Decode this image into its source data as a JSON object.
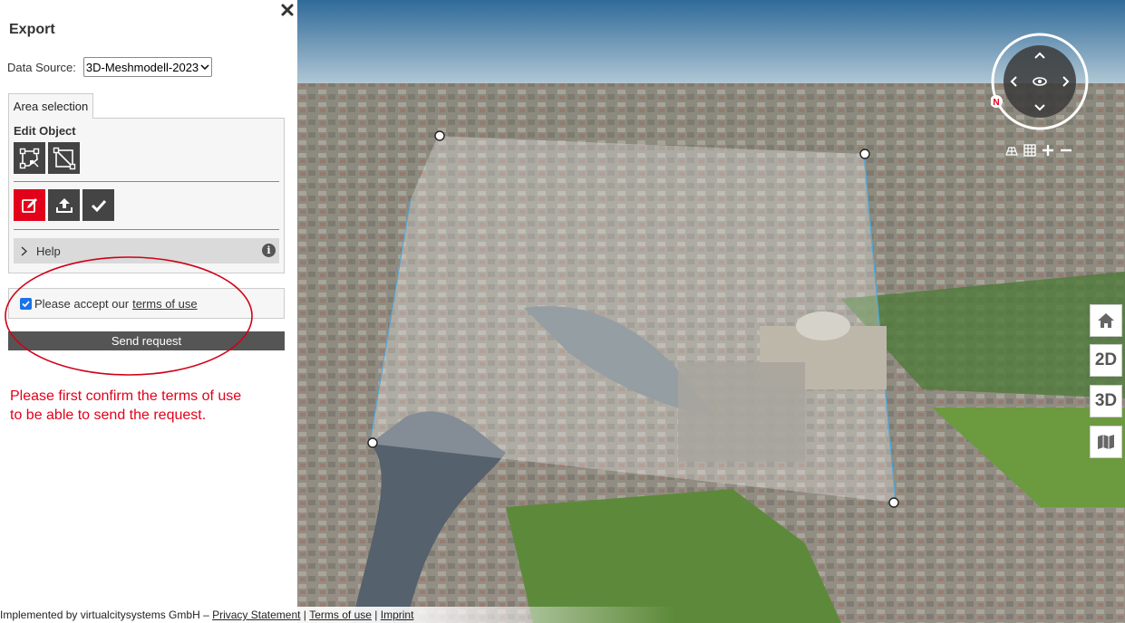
{
  "panel": {
    "title": "Export",
    "data_source_label": "Data Source:",
    "data_source_value": "3D-Meshmodell-2023",
    "tab_label": "Area selection",
    "edit_object_label": "Edit Object",
    "help_label": "Help",
    "terms_text": "Please accept our",
    "terms_link": "terms of use",
    "terms_checked": true,
    "send_button": "Send request",
    "annotation_line1": "Please first confirm the terms of use",
    "annotation_line2": "to be able to send the request."
  },
  "map": {
    "compass_letter": "N",
    "side_buttons": {
      "btn_2d": "2D",
      "btn_3d": "3D"
    }
  },
  "footer": {
    "prefix": "Implemented by virtualcitysystems GmbH – ",
    "privacy": "Privacy Statement",
    "sep1": " | ",
    "terms": "Terms of use",
    "sep2": " | ",
    "imprint": "Imprint"
  },
  "colors": {
    "accent_red": "#e2001a",
    "button_dark": "#444444",
    "checkbox_blue": "#1a73e8"
  }
}
